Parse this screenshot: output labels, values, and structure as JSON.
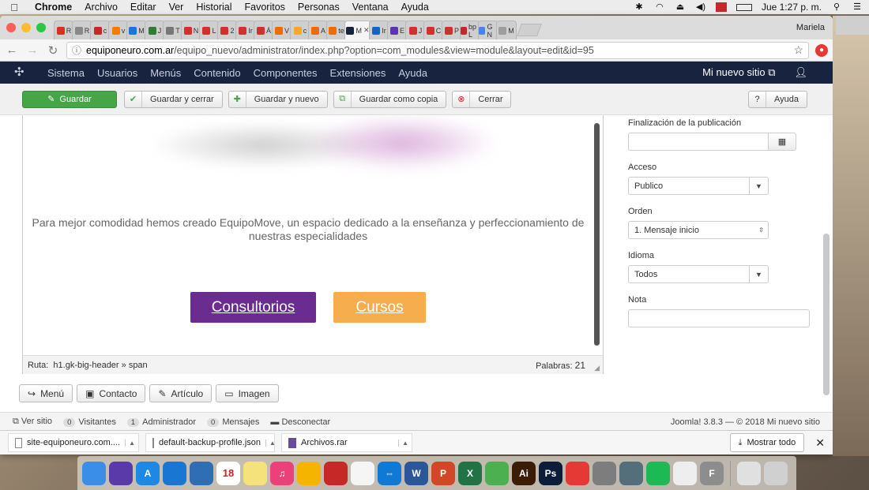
{
  "menubar": {
    "app": "Chrome",
    "items": [
      "Archivo",
      "Editar",
      "Ver",
      "Historial",
      "Favoritos",
      "Personas",
      "Ventana",
      "Ayuda"
    ],
    "clock": "Jue 1:27 p. m.",
    "user": "Mariela"
  },
  "browser": {
    "tabs": [
      {
        "label": "R",
        "color": "#d93025"
      },
      {
        "label": "R",
        "color": "#888888"
      },
      {
        "label": "c",
        "color": "#c62828"
      },
      {
        "label": "v",
        "color": "#f57c00"
      },
      {
        "label": "M",
        "color": "#1a73e8"
      },
      {
        "label": "J",
        "color": "#2e7d32"
      },
      {
        "label": "T",
        "color": "#777777"
      },
      {
        "label": "N",
        "color": "#d32f2f"
      },
      {
        "label": "L",
        "color": "#d32f2f"
      },
      {
        "label": "2",
        "color": "#d32f2f"
      },
      {
        "label": "Ir",
        "color": "#d32f2f"
      },
      {
        "label": "Á",
        "color": "#d32f2f"
      },
      {
        "label": "V",
        "color": "#ef6c00"
      },
      {
        "label": "c",
        "color": "#f9a825"
      },
      {
        "label": "A",
        "color": "#ef6c00"
      },
      {
        "label": "te",
        "color": "#ef6c00"
      },
      {
        "label": "M",
        "color": "#17233f",
        "active": true
      },
      {
        "label": "Ir",
        "color": "#1565c0"
      },
      {
        "label": "E",
        "color": "#5e35b1"
      },
      {
        "label": "J",
        "color": "#d32f2f"
      },
      {
        "label": "C",
        "color": "#d32f2f"
      },
      {
        "label": "P",
        "color": "#d32f2f"
      },
      {
        "label": "bp L",
        "color": "#c62828"
      },
      {
        "label": "G N",
        "color": "#4285f4"
      },
      {
        "label": "M",
        "color": "#9e9e9e"
      }
    ],
    "url_host": "equiponeuro.com.ar",
    "url_path": "/equipo_nuevo/administrator/index.php?option=com_modules&view=module&layout=edit&id=95"
  },
  "joomla_nav": {
    "items": [
      "Sistema",
      "Usuarios",
      "Menús",
      "Contenido",
      "Componentes",
      "Extensiones",
      "Ayuda"
    ],
    "site_link": "Mi nuevo sitio ⧉",
    "user_icon": "user-icon"
  },
  "toolbar": {
    "save": "Guardar",
    "save_close": "Guardar y cerrar",
    "save_new": "Guardar y nuevo",
    "save_copy": "Guardar como copia",
    "close": "Cerrar",
    "help": "Ayuda"
  },
  "editor": {
    "blurb": "Para mejor comodidad hemos creado EquipoMove, un espacio dedicado a la enseñanza y perfeccionamiento de nuestras especialidades",
    "btn_consultorios": "Consultorios",
    "btn_cursos": "Cursos",
    "path_label": "Ruta:",
    "path_value": "h1.gk-big-header » span",
    "words_label": "Palabras:",
    "words_count": "21",
    "colors": {
      "consultorios": "#6a2c91",
      "cursos": "#f6ad4d"
    }
  },
  "editor_buttons": [
    "Menú",
    "Contacto",
    "Artículo",
    "Imagen"
  ],
  "side_fields": {
    "finish_label": "Finalización de la publicación",
    "finish_value": "",
    "access_label": "Acceso",
    "access_value": "Publico",
    "order_label": "Orden",
    "order_value": "1. Mensaje inicio",
    "lang_label": "Idioma",
    "lang_value": "Todos",
    "note_label": "Nota",
    "note_value": ""
  },
  "footer": {
    "view_site": "Ver sitio",
    "visitors_count": "0",
    "visitors": "Visitantes",
    "admins_count": "1",
    "admins": "Administrador",
    "messages_count": "0",
    "messages": "Mensajes",
    "logout": "Desconectar",
    "version": "Joomla! 3.8.3 — © 2018 Mi nuevo sitio"
  },
  "downloads": {
    "items": [
      "site-equiponeuro.com.....zip",
      "default-backup-profile.json",
      "Archivos.rar"
    ],
    "show_all": "Mostrar todo"
  },
  "dock": {
    "calendar_day": "18",
    "apps": [
      {
        "name": "finder-icon",
        "color": "#3b8ee8",
        "glyph": ""
      },
      {
        "name": "siri-icon",
        "color": "#5a3aa8",
        "glyph": ""
      },
      {
        "name": "app-store-icon",
        "color": "#1e88e5",
        "glyph": "A"
      },
      {
        "name": "safari-icon",
        "color": "#1976d2",
        "glyph": ""
      },
      {
        "name": "preview-icon",
        "color": "#2f6db5",
        "glyph": ""
      },
      {
        "name": "calendar-icon",
        "color": "#ffffff",
        "glyph": "18"
      },
      {
        "name": "notes-icon",
        "color": "#f5e27a",
        "glyph": ""
      },
      {
        "name": "itunes-icon",
        "color": "#ec407a",
        "glyph": "♫"
      },
      {
        "name": "photos-icon",
        "color": "#f4b400",
        "glyph": ""
      },
      {
        "name": "filezilla-icon",
        "color": "#c62828",
        "glyph": ""
      },
      {
        "name": "reminders-icon",
        "color": "#f5f5f5",
        "glyph": ""
      },
      {
        "name": "teamviewer-icon",
        "color": "#0e7ad6",
        "glyph": "⇔"
      },
      {
        "name": "word-icon",
        "color": "#2b579a",
        "glyph": "W"
      },
      {
        "name": "powerpoint-icon",
        "color": "#d24726",
        "glyph": "P"
      },
      {
        "name": "excel-icon",
        "color": "#217346",
        "glyph": "X"
      },
      {
        "name": "chrome-icon",
        "color": "#4caf50",
        "glyph": ""
      },
      {
        "name": "illustrator-icon",
        "color": "#3a1d04",
        "glyph": "Ai"
      },
      {
        "name": "photoshop-icon",
        "color": "#0b1d3a",
        "glyph": "Ps"
      },
      {
        "name": "acrobat-icon",
        "color": "#e53935",
        "glyph": ""
      },
      {
        "name": "system-preferences-icon",
        "color": "#7d7d7d",
        "glyph": ""
      },
      {
        "name": "network-icon",
        "color": "#546e7a",
        "glyph": ""
      },
      {
        "name": "spotify-icon",
        "color": "#1db954",
        "glyph": ""
      },
      {
        "name": "textedit-icon",
        "color": "#eeeeee",
        "glyph": ""
      },
      {
        "name": "font-book-icon",
        "color": "#8d8d8d",
        "glyph": "F"
      },
      {
        "name": "downloads-stack-icon",
        "color": "#e0e0e0",
        "glyph": ""
      },
      {
        "name": "trash-icon",
        "color": "#d0d0d0",
        "glyph": ""
      }
    ]
  }
}
